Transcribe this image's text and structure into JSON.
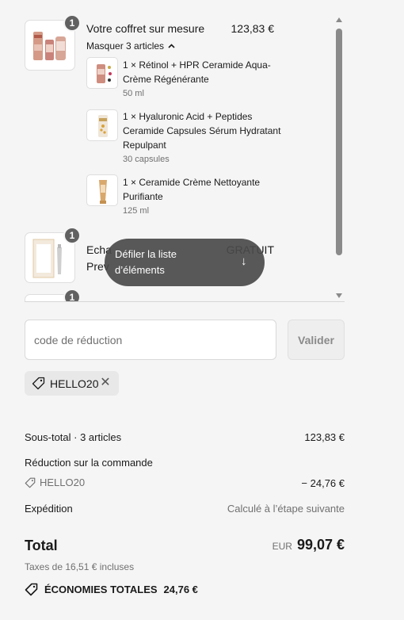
{
  "line_items": [
    {
      "quantity": "1",
      "title": "Votre coffret sur mesure",
      "price": "123,83 €",
      "toggle_label": "Masquer 3 articles",
      "bundle_items": [
        {
          "name": "1 × Rétinol + HPR Ceramide Aqua-Crème Régénérante",
          "detail": "50 ml"
        },
        {
          "name": "1 × Hyaluronic Acid + Peptides Ceramide Capsules Sérum Hydratant Repulpant",
          "detail": "30 capsules"
        },
        {
          "name": "1 × Ceramide Crème Nettoyante Purifiante",
          "detail": "125 ml"
        }
      ]
    },
    {
      "quantity": "1",
      "title_visible_start": "Echa",
      "title_visible_line2": "Prev",
      "price": "GRATUIT"
    },
    {
      "quantity": "1"
    }
  ],
  "scroll_hint": "Défiler la liste d’éléments",
  "discount": {
    "placeholder": "code de réduction",
    "value": "",
    "apply_label": "Valider",
    "applied_code": "HELLO20"
  },
  "summary": {
    "subtotal_label": "Sous-total · 3 articles",
    "subtotal_value": "123,83 €",
    "order_discount_label": "Réduction sur la commande",
    "order_discount_code": "HELLO20",
    "order_discount_value": "− 24,76 €",
    "shipping_label": "Expédition",
    "shipping_value": "Calculé à l’étape suivante",
    "total_label": "Total",
    "currency": "EUR",
    "total_value": "99,07 €",
    "tax_note": "Taxes de 16,51 € incluses",
    "savings_label": "ÉCONOMIES TOTALES",
    "savings_value": "24,76 €"
  },
  "icons": {
    "toggle": "chevron-up-icon",
    "scroll": "arrow-down-icon",
    "tag": "tag-icon",
    "remove": "close-icon"
  },
  "colors": {
    "background": "#f5f5f5",
    "badge": "#616161",
    "tooltip": "#4a4a4a",
    "muted_text": "#707070"
  }
}
